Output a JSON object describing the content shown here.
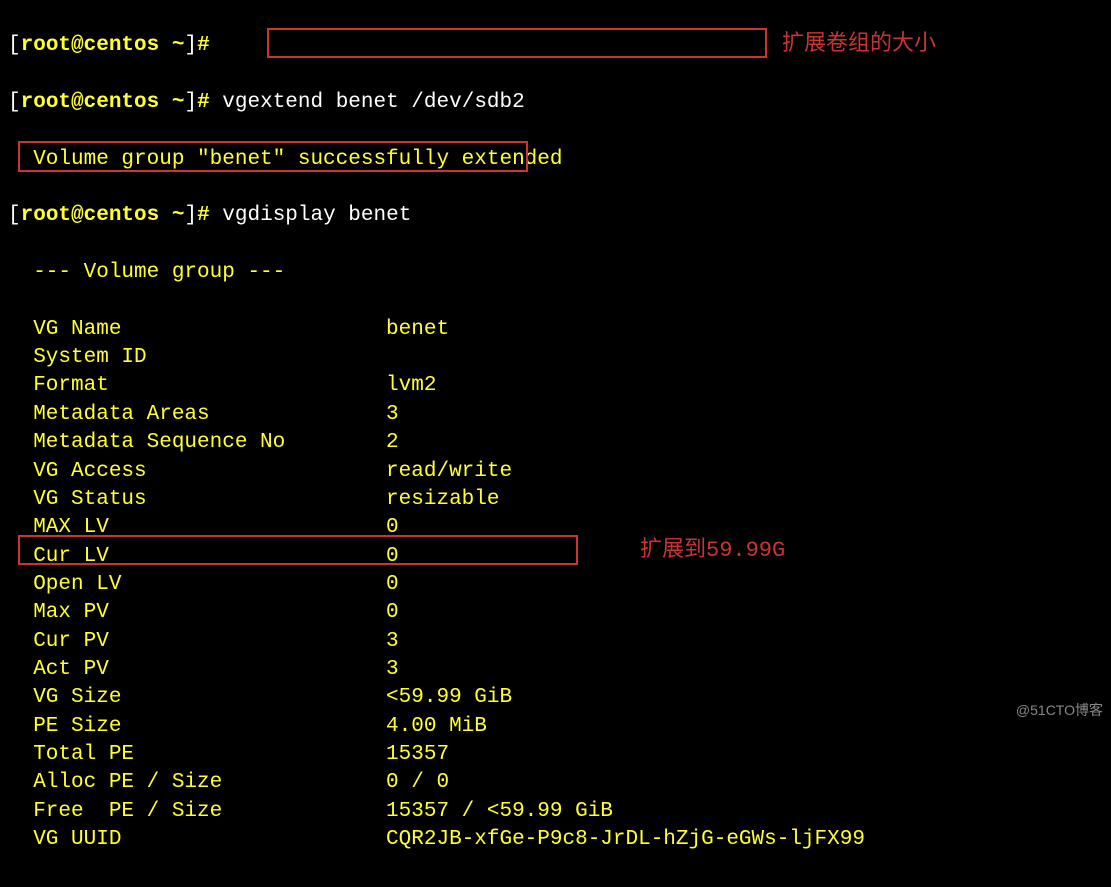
{
  "prompt_user": "root@centos",
  "prompt_path": "~",
  "hash": "#",
  "cmd1": "vgextend benet /dev/sdb2",
  "out1": "  Volume group \"benet\" successfully extended",
  "cmd2": "vgdisplay benet",
  "header": "  --- Volume group ---",
  "fields": [
    {
      "label": "VG Name",
      "value": "benet"
    },
    {
      "label": "System ID",
      "value": ""
    },
    {
      "label": "Format",
      "value": "lvm2"
    },
    {
      "label": "Metadata Areas",
      "value": "3"
    },
    {
      "label": "Metadata Sequence No",
      "value": "2"
    },
    {
      "label": "VG Access",
      "value": "read/write"
    },
    {
      "label": "VG Status",
      "value": "resizable"
    },
    {
      "label": "MAX LV",
      "value": "0"
    },
    {
      "label": "Cur LV",
      "value": "0"
    },
    {
      "label": "Open LV",
      "value": "0"
    },
    {
      "label": "Max PV",
      "value": "0"
    },
    {
      "label": "Cur PV",
      "value": "3"
    },
    {
      "label": "Act PV",
      "value": "3"
    },
    {
      "label": "VG Size",
      "value": "<59.99 GiB"
    },
    {
      "label": "PE Size",
      "value": "4.00 MiB"
    },
    {
      "label": "Total PE",
      "value": "15357"
    },
    {
      "label": "Alloc PE / Size",
      "value": "0 / 0"
    },
    {
      "label": "Free  PE / Size",
      "value": "15357 / <59.99 GiB"
    },
    {
      "label": "VG UUID",
      "value": "CQR2JB-xfGe-P9c8-JrDL-hZjG-eGWs-ljFX99"
    }
  ],
  "annot1": "扩展卷组的大小",
  "annot2": "扩展到59.99G",
  "watermark": "@51CTO博客"
}
